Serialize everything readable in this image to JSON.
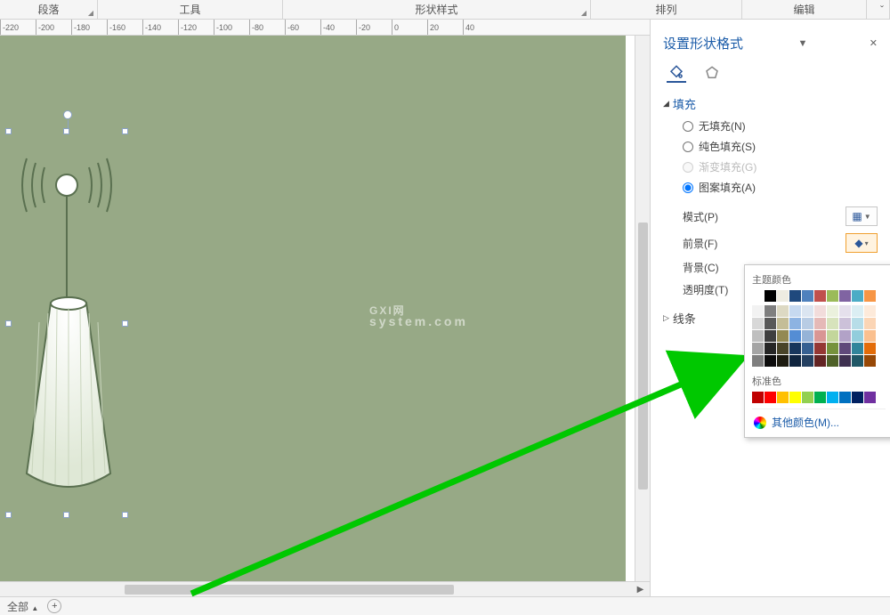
{
  "ribbon_groups": [
    "段落",
    "工具",
    "形状样式",
    "排列",
    "编辑"
  ],
  "ruler_ticks": [
    "-220",
    "-200",
    "-180",
    "-160",
    "-140",
    "-120",
    "-100",
    "-80",
    "-60",
    "-40",
    "-20",
    "0",
    "20",
    "40"
  ],
  "watermark": {
    "line1": "GXI网",
    "line2": "system.com"
  },
  "panel": {
    "title": "设置形状格式",
    "fill": {
      "head": "填充",
      "none": "无填充(N)",
      "solid": "纯色填充(S)",
      "gradient": "渐变填充(G)",
      "pattern": "图案填充(A)"
    },
    "rows": {
      "mode": "模式(P)",
      "fg": "前景(F)",
      "bg": "背景(C)",
      "trans": "透明度(T)"
    },
    "line_head": "线条",
    "popup": {
      "theme": "主题颜色",
      "standard": "标准色",
      "other": "其他颜色(M)...",
      "theme_row1": [
        "#ffffff",
        "#000000",
        "#eeece1",
        "#1f497d",
        "#4f81bd",
        "#c0504d",
        "#9bbb59",
        "#8064a2",
        "#4bacc6",
        "#f79646"
      ],
      "theme_shades": [
        [
          "#f2f2f2",
          "#7f7f7f",
          "#ddd9c3",
          "#c6d9f0",
          "#dbe5f1",
          "#f2dcdb",
          "#ebf1dd",
          "#e5e0ec",
          "#dbeef3",
          "#fdeada"
        ],
        [
          "#d8d8d8",
          "#595959",
          "#c4bd97",
          "#8db3e2",
          "#b8cce4",
          "#e5b9b7",
          "#d7e3bc",
          "#ccc1d9",
          "#b7dde8",
          "#fbd5b5"
        ],
        [
          "#bfbfbf",
          "#3f3f3f",
          "#938953",
          "#548dd4",
          "#95b3d7",
          "#d99694",
          "#c3d69b",
          "#b2a2c7",
          "#92cddc",
          "#fac08f"
        ],
        [
          "#a5a5a5",
          "#262626",
          "#494429",
          "#17365d",
          "#366092",
          "#953734",
          "#76923c",
          "#5f497a",
          "#31859b",
          "#e36c09"
        ],
        [
          "#7f7f7f",
          "#0c0c0c",
          "#1d1b10",
          "#0f243e",
          "#244061",
          "#632423",
          "#4f6128",
          "#3f3151",
          "#205867",
          "#974806"
        ]
      ],
      "standard_row": [
        "#c00000",
        "#ff0000",
        "#ffc000",
        "#ffff00",
        "#92d050",
        "#00b050",
        "#00b0f0",
        "#0070c0",
        "#002060",
        "#7030a0"
      ]
    }
  },
  "status": {
    "page": "全部",
    "caret": "▲"
  }
}
